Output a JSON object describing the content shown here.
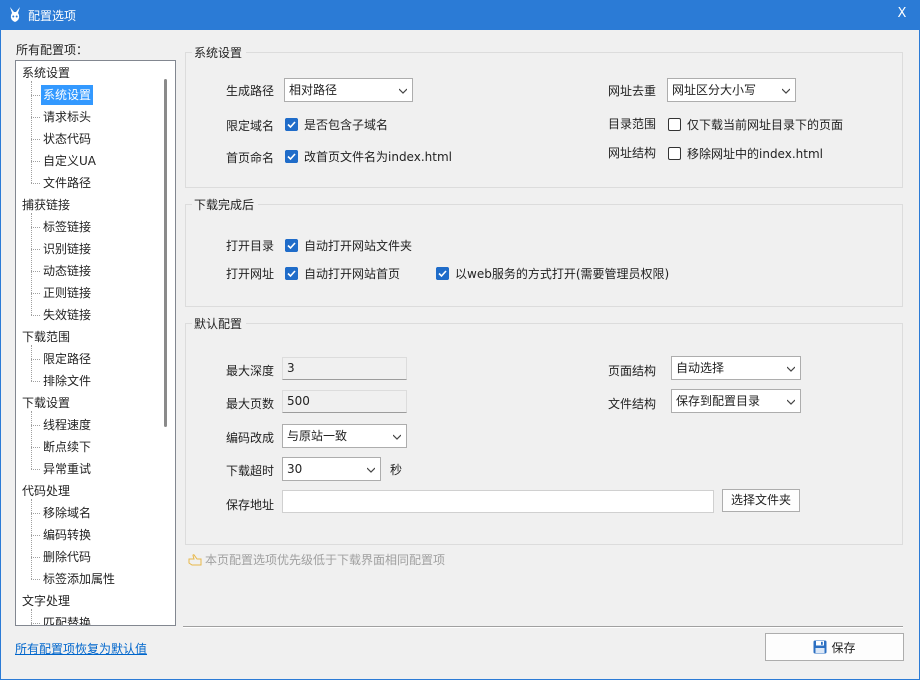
{
  "window": {
    "title": "配置选项",
    "close_label": "X"
  },
  "tree": {
    "label": "所有配置项：",
    "categories": [
      {
        "label": "系统设置",
        "items": [
          "系统设置",
          "请求标头",
          "状态代码",
          "自定义UA",
          "文件路径"
        ]
      },
      {
        "label": "捕获链接",
        "items": [
          "标签链接",
          "识别链接",
          "动态链接",
          "正则链接",
          "失效链接"
        ]
      },
      {
        "label": "下载范围",
        "items": [
          "限定路径",
          "排除文件"
        ]
      },
      {
        "label": "下载设置",
        "items": [
          "线程速度",
          "断点续下",
          "异常重试"
        ]
      },
      {
        "label": "代码处理",
        "items": [
          "移除域名",
          "编码转换",
          "删除代码",
          "标签添加属性"
        ]
      },
      {
        "label": "文字处理",
        "items": [
          "匹配替换"
        ]
      }
    ],
    "selected": "系统设置"
  },
  "system_group": {
    "title": "系统设置",
    "path_label": "生成路径",
    "path_value": "相对路径",
    "domain_label": "限定域名",
    "domain_check": "是否包含子域名",
    "domain_checked": true,
    "homepage_label": "首页命名",
    "homepage_check": "改首页文件名为index.html",
    "homepage_checked": true,
    "dedupe_label": "网址去重",
    "dedupe_value": "网址区分大小写",
    "dir_label": "目录范围",
    "dir_check": "仅下载当前网址目录下的页面",
    "dir_checked": false,
    "url_label": "网址结构",
    "url_check": "移除网址中的index.html",
    "url_checked": false
  },
  "after_group": {
    "title": "下载完成后",
    "open_dir_label": "打开目录",
    "open_dir_check": "自动打开网站文件夹",
    "open_dir_checked": true,
    "open_url_label": "打开网址",
    "open_url_check": "自动打开网站首页",
    "open_url_checked": true,
    "web_service_check": "以web服务的方式打开(需要管理员权限)",
    "web_service_checked": true
  },
  "default_group": {
    "title": "默认配置",
    "depth_label": "最大深度",
    "depth_value": "3",
    "pages_label": "最大页数",
    "pages_value": "500",
    "encoding_label": "编码改成",
    "encoding_value": "与原站一致",
    "timeout_label": "下载超时",
    "timeout_value": "30",
    "timeout_unit": "秒",
    "save_label": "保存地址",
    "save_value": "",
    "browse_label": "选择文件夹",
    "page_struct_label": "页面结构",
    "page_struct_value": "自动选择",
    "file_struct_label": "文件结构",
    "file_struct_value": "保存到配置目录"
  },
  "hint": "本页配置选项优先级低于下载界面相同配置项",
  "footer": {
    "reset_link": "所有配置项恢复为默认值",
    "save_label": "保存"
  },
  "colors": {
    "titlebar": "#2b7bd6",
    "accent": "#1f6cc9",
    "selection": "#3399ff",
    "link": "#0066cc"
  }
}
